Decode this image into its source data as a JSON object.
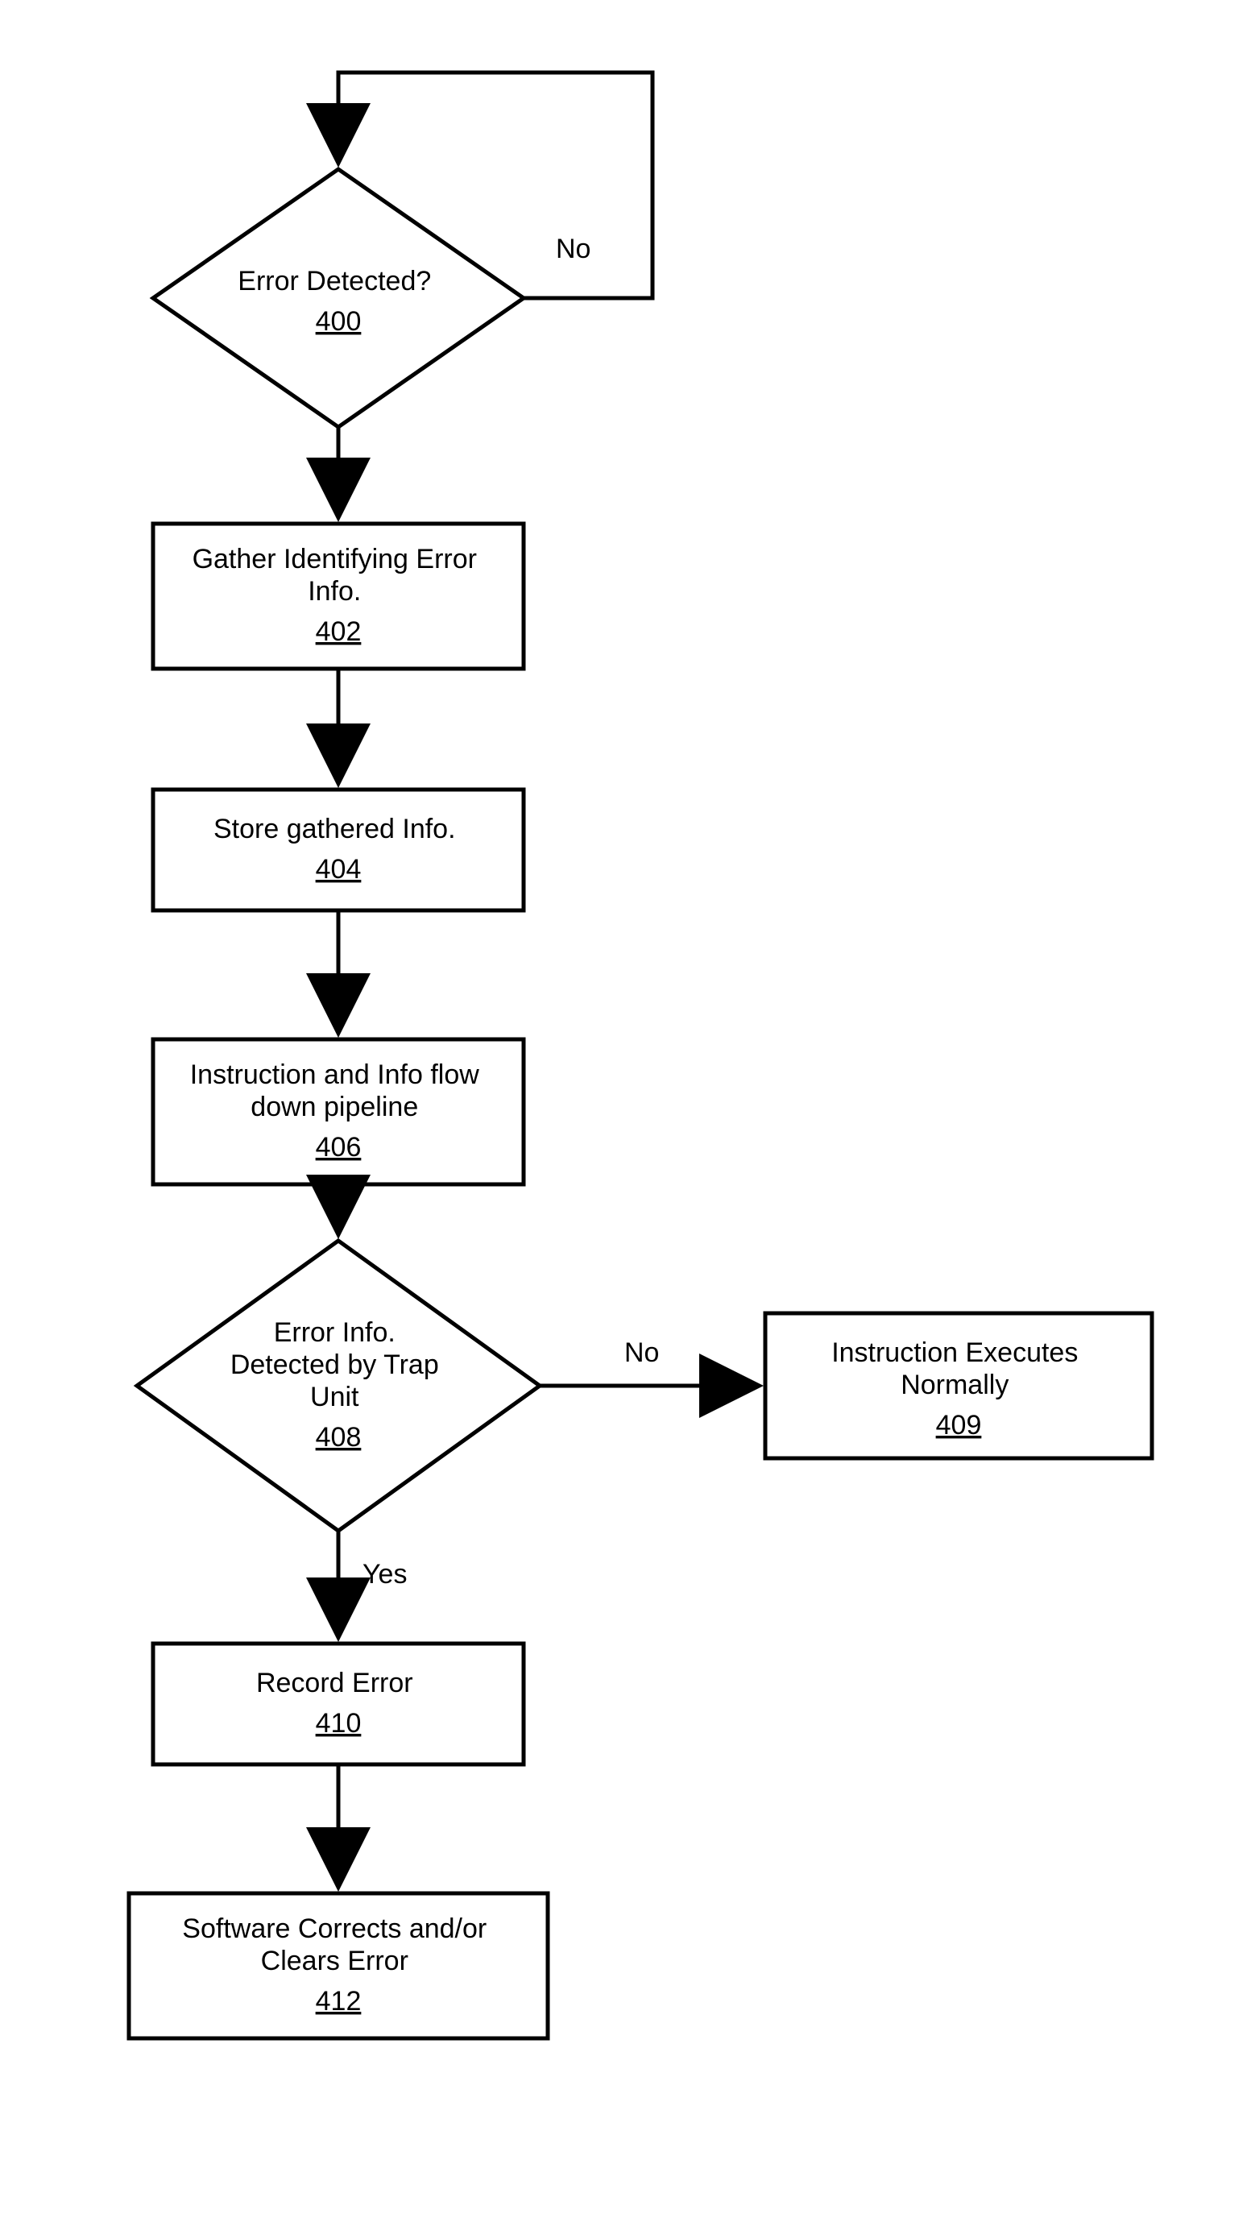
{
  "nodes": {
    "d400": {
      "label": "Error Detected?",
      "ref": "400"
    },
    "b402": {
      "label": "Gather Identifying Error Info.",
      "ref": "402"
    },
    "b404": {
      "label": "Store gathered Info.",
      "ref": "404"
    },
    "b406": {
      "label": "Instruction and Info flow down pipeline",
      "ref": "406"
    },
    "d408": {
      "label": "Error Info. Detected by Trap Unit",
      "ref": "408"
    },
    "b409": {
      "label": "Instruction Executes Normally",
      "ref": "409"
    },
    "b410": {
      "label": "Record Error",
      "ref": "410"
    },
    "b412": {
      "label": "Software Corrects and/or Clears Error",
      "ref": "412"
    }
  },
  "edges": {
    "no1": "No",
    "no2": "No",
    "yes": "Yes"
  }
}
